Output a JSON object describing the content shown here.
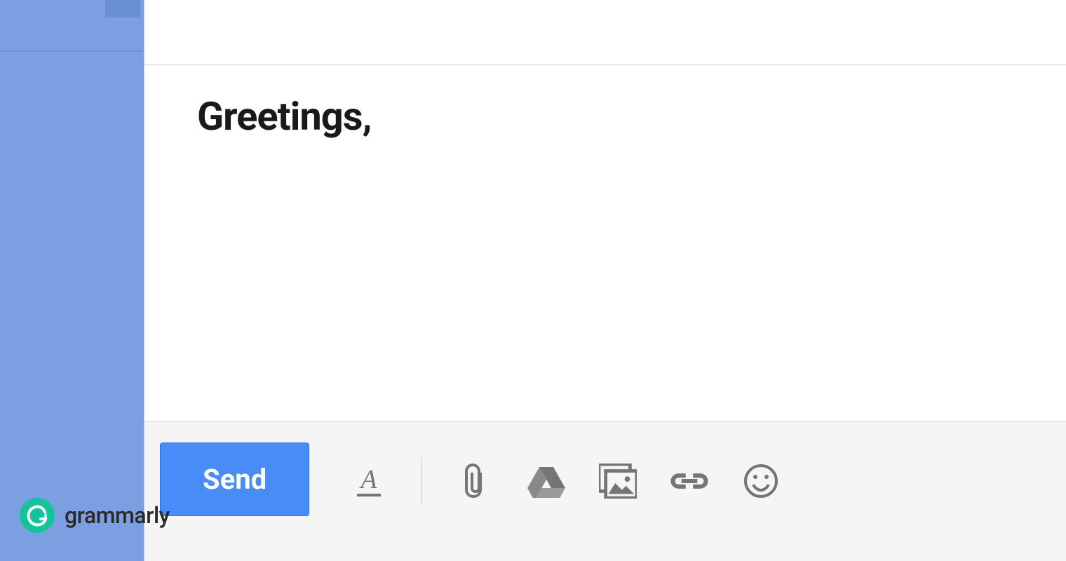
{
  "compose": {
    "body_text": "Greetings,",
    "send_label": "Send"
  },
  "toolbar_icons": {
    "format": "format-text-icon",
    "attach": "paperclip-icon",
    "drive": "drive-icon",
    "image": "image-icon",
    "link": "link-icon",
    "emoji": "emoji-icon"
  },
  "brand": {
    "name": "grammarly"
  },
  "colors": {
    "sidebar": "#7B9FE0",
    "send_button": "#4A8CF7",
    "icon": "#757575",
    "grammarly": "#15C39A"
  }
}
